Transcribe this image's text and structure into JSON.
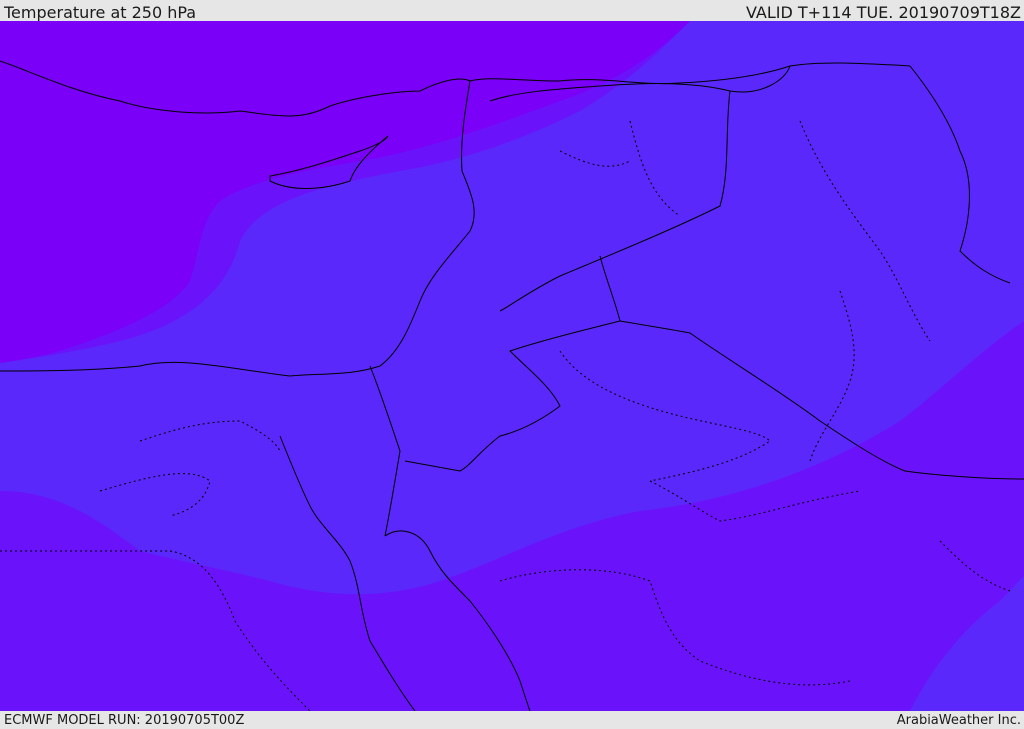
{
  "header": {
    "title": "Temperature at 250 hPa",
    "valid": "VALID T+114 TUE. 20190709T18Z"
  },
  "footer": {
    "model_run": "ECMWF MODEL RUN: 20190705T00Z",
    "credit": "ArabiaWeather Inc."
  },
  "colors": {
    "coldest": "#7a00f7",
    "cold": "#6a13fb",
    "mid": "#5a28fa",
    "border": "#000000"
  },
  "icons": []
}
